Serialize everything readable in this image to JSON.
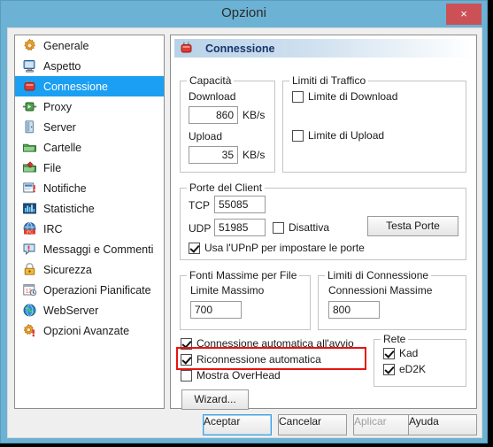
{
  "window": {
    "title": "Opzioni",
    "close_label": "×"
  },
  "sidebar": {
    "items": [
      {
        "label": "Generale",
        "icon": "gear-icon",
        "selected": false
      },
      {
        "label": "Aspetto",
        "icon": "monitor-icon",
        "selected": false
      },
      {
        "label": "Connessione",
        "icon": "plug-icon",
        "selected": true
      },
      {
        "label": "Proxy",
        "icon": "proxy-icon",
        "selected": false
      },
      {
        "label": "Server",
        "icon": "server-door-icon",
        "selected": false
      },
      {
        "label": "Cartelle",
        "icon": "folder-icon",
        "selected": false
      },
      {
        "label": "File",
        "icon": "file-folder-icon",
        "selected": false
      },
      {
        "label": "Notifiche",
        "icon": "notification-icon",
        "selected": false
      },
      {
        "label": "Statistiche",
        "icon": "statistics-icon",
        "selected": false
      },
      {
        "label": "IRC",
        "icon": "irc-icon",
        "selected": false
      },
      {
        "label": "Messaggi e Commenti",
        "icon": "messages-icon",
        "selected": false
      },
      {
        "label": "Sicurezza",
        "icon": "lock-icon",
        "selected": false
      },
      {
        "label": "Operazioni Pianificate",
        "icon": "calendar-clock-icon",
        "selected": false
      },
      {
        "label": "WebServer",
        "icon": "globe-icon",
        "selected": false
      },
      {
        "label": "Opzioni Avanzate",
        "icon": "advanced-gear-icon",
        "selected": false
      }
    ]
  },
  "panel": {
    "header_title": "Connessione",
    "capacity": {
      "group_title": "Capacità",
      "download_label": "Download",
      "download_value": "860",
      "download_unit": "KB/s",
      "upload_label": "Upload",
      "upload_value": "35",
      "upload_unit": "KB/s"
    },
    "traffic_limits": {
      "group_title": "Limiti di Traffico",
      "download_limit_label": "Limite di Download",
      "download_limit_checked": false,
      "upload_limit_label": "Limite di Upload",
      "upload_limit_checked": false
    },
    "client_ports": {
      "group_title": "Porte del Client",
      "tcp_label": "TCP",
      "tcp_value": "55085",
      "udp_label": "UDP",
      "udp_value": "51985",
      "disable_label": "Disattiva",
      "disable_checked": false,
      "upnp_label": "Usa l'UPnP per impostare le porte",
      "upnp_checked": true,
      "test_ports_button": "Testa Porte"
    },
    "max_sources": {
      "group_title": "Fonti Massime per File",
      "limit_label": "Limite Massimo",
      "limit_value": "700"
    },
    "connection_limits": {
      "group_title": "Limiti di Connessione",
      "max_label": "Connessioni Massime",
      "max_value": "800"
    },
    "options": {
      "autoconnect_label": "Connessione automatica all'avvio",
      "autoconnect_checked": true,
      "reconnect_label": "Riconnessione automatica",
      "reconnect_checked": true,
      "reconnect_highlighted": true,
      "overhead_label": "Mostra OverHead",
      "overhead_checked": false,
      "wizard_button": "Wizard..."
    },
    "network": {
      "group_title": "Rete",
      "kad_label": "Kad",
      "kad_checked": true,
      "ed2k_label": "eD2K",
      "ed2k_checked": true
    }
  },
  "footer": {
    "ok_label": "Aceptar",
    "cancel_label": "Cancelar",
    "apply_label": "Aplicar",
    "apply_disabled": true,
    "help_label": "Ayuda"
  },
  "colors": {
    "window_frame": "#6cb2d4",
    "close_button": "#cb5156",
    "selection": "#1a9ff2",
    "highlight": "#e81313",
    "header_text": "#16366b"
  }
}
